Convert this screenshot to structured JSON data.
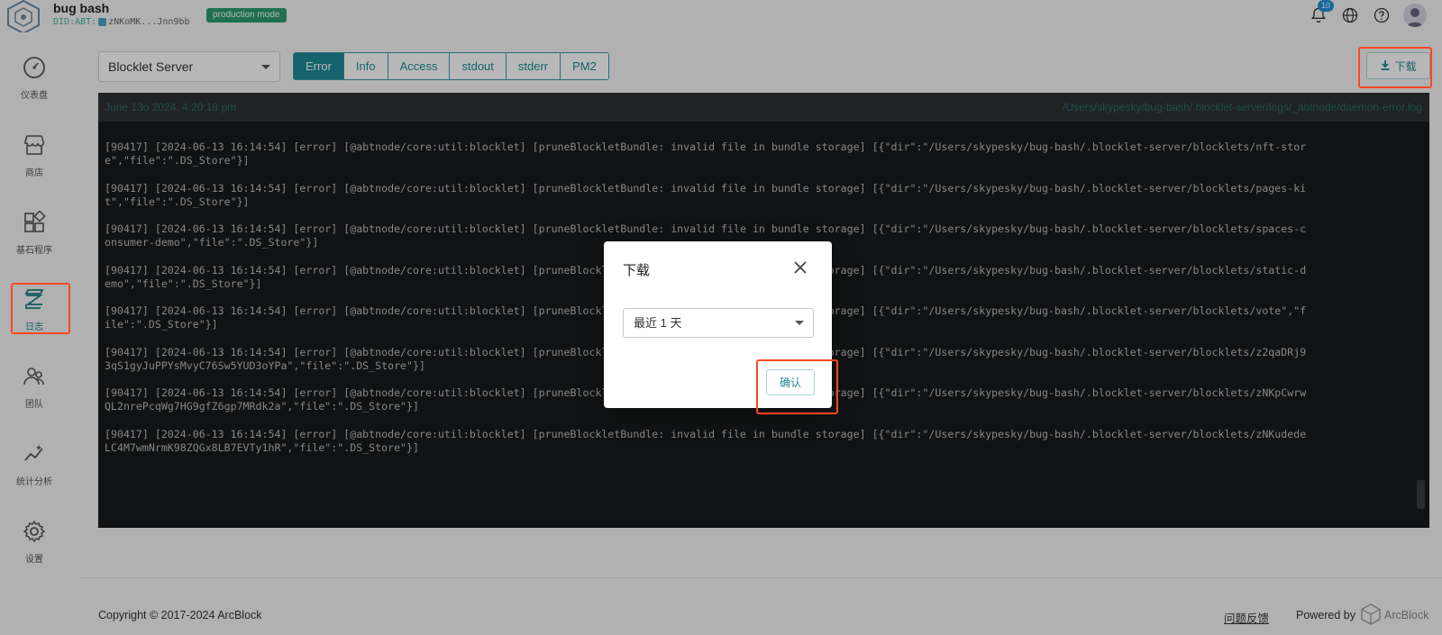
{
  "header": {
    "app_title": "bug bash",
    "did_prefix": "DID:ABT:",
    "did_value": "zNKoMK...Jnn9bb",
    "mode_badge": "production mode",
    "notification_count": "10"
  },
  "sidebar": {
    "items": [
      {
        "label": "仪表盘",
        "icon": "dashboard-gauge-icon"
      },
      {
        "label": "商店",
        "icon": "store-icon"
      },
      {
        "label": "基石程序",
        "icon": "blocklets-icon"
      },
      {
        "label": "日志",
        "icon": "logs-icon",
        "active": true
      },
      {
        "label": "团队",
        "icon": "team-icon"
      },
      {
        "label": "统计分析",
        "icon": "analytics-icon"
      },
      {
        "label": "设置",
        "icon": "settings-gear-icon"
      }
    ]
  },
  "toolbar": {
    "source_select": "Blocklet Server",
    "tabs": [
      "Error",
      "Info",
      "Access",
      "stdout",
      "stderr",
      "PM2"
    ],
    "active_tab": "Error",
    "download_label": "下载"
  },
  "log": {
    "date": "June 13o 2024, 4:20:18 pm",
    "path": "/Users/skypesky/bug-bash/.blocklet-server/logs/_abtnode/daemon-error.log",
    "lines": [
      "[90417] [2024-06-13 16:14:54] [error] [@abtnode/core:util:blocklet] [pruneBlockletBundle: invalid file in bundle storage] [{\"dir\":\"/Users/skypesky/bug-bash/.blocklet-server/blocklets/nft-stor\ne\",\"file\":\".DS_Store\"}]",
      "[90417] [2024-06-13 16:14:54] [error] [@abtnode/core:util:blocklet] [pruneBlockletBundle: invalid file in bundle storage] [{\"dir\":\"/Users/skypesky/bug-bash/.blocklet-server/blocklets/pages-ki\nt\",\"file\":\".DS_Store\"}]",
      "[90417] [2024-06-13 16:14:54] [error] [@abtnode/core:util:blocklet] [pruneBlockletBundle: invalid file in bundle storage] [{\"dir\":\"/Users/skypesky/bug-bash/.blocklet-server/blocklets/spaces-c\nonsumer-demo\",\"file\":\".DS_Store\"}]",
      "[90417] [2024-06-13 16:14:54] [error] [@abtnode/core:util:blocklet] [pruneBlockletBundle: invalid file in bundle storage] [{\"dir\":\"/Users/skypesky/bug-bash/.blocklet-server/blocklets/static-d\nemo\",\"file\":\".DS_Store\"}]",
      "[90417] [2024-06-13 16:14:54] [error] [@abtnode/core:util:blocklet] [pruneBlockletBundle: invalid file in bundle storage] [{\"dir\":\"/Users/skypesky/bug-bash/.blocklet-server/blocklets/vote\",\"f\nile\":\".DS_Store\"}]",
      "[90417] [2024-06-13 16:14:54] [error] [@abtnode/core:util:blocklet] [pruneBlockletBundle: invalid file in bundle storage] [{\"dir\":\"/Users/skypesky/bug-bash/.blocklet-server/blocklets/z2qaDRj9\n3qS1gyJuPPYsMvyC76Sw5YUD3oYPa\",\"file\":\".DS_Store\"}]",
      "[90417] [2024-06-13 16:14:54] [error] [@abtnode/core:util:blocklet] [pruneBlockletBundle: invalid file in bundle storage] [{\"dir\":\"/Users/skypesky/bug-bash/.blocklet-server/blocklets/zNKpCwrw\nQL2nrePcqWg7HG9gfZ6gp7MRdk2a\",\"file\":\".DS_Store\"}]",
      "[90417] [2024-06-13 16:14:54] [error] [@abtnode/core:util:blocklet] [pruneBlockletBundle: invalid file in bundle storage] [{\"dir\":\"/Users/skypesky/bug-bash/.blocklet-server/blocklets/zNKudede\nLC4M7wmNrmK98ZQGx8LB7EVTy1hR\",\"file\":\".DS_Store\"}]"
    ]
  },
  "dialog": {
    "title": "下载",
    "range_select": "最近 1 天",
    "confirm_label": "确认"
  },
  "footer": {
    "copyright": "Copyright © 2017-2024  ArcBlock",
    "feedback": "问题反馈",
    "powered_by": "Powered by",
    "brand": "ArcBlock"
  },
  "colors": {
    "accent": "#1d8a97",
    "highlight": "#ff4722",
    "badge": "#2a9c6c",
    "log_bg": "#18191b"
  }
}
